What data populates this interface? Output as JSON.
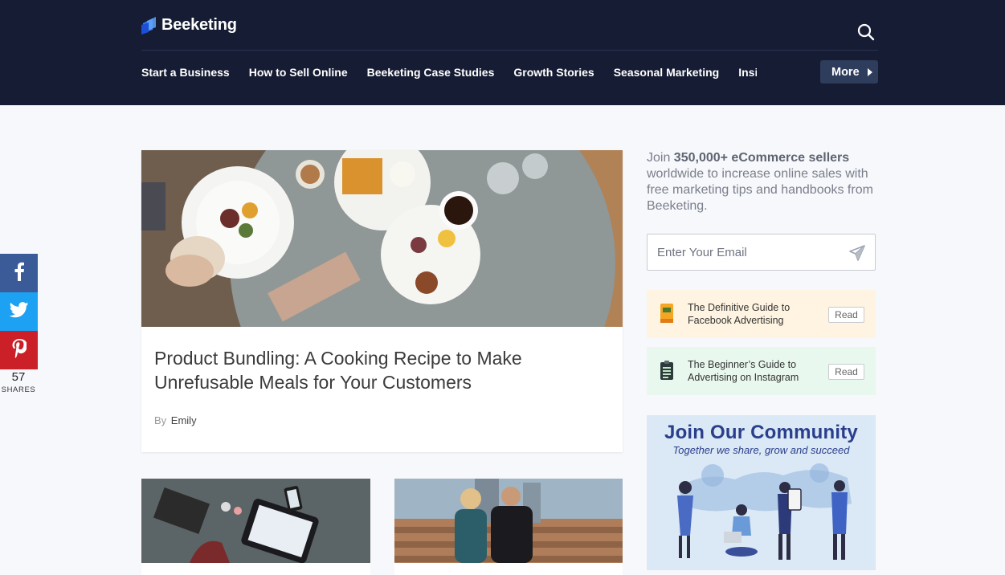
{
  "header": {
    "brand": "Beeketing",
    "nav_items": [
      "Start a Business",
      "How to Sell Online",
      "Beeketing Case Studies",
      "Growth Stories",
      "Seasonal Marketing",
      "Insid"
    ],
    "more_label": "More",
    "search_icon": "search-icon"
  },
  "share_bar": {
    "facebook": "f",
    "twitter": "twitter-icon",
    "pinterest": "P",
    "count": "57",
    "count_label": "SHARES"
  },
  "main_article": {
    "title": "Product Bundling: A Cooking Recipe to Make Unrefusable Meals for Your Customers",
    "by_label": "By",
    "author": "Emily"
  },
  "sidebar": {
    "intro_prefix": "Join ",
    "intro_bold": "350,000+ eCommerce sellers",
    "intro_rest": " worldwide to increase online sales with free marketing tips and handbooks from Beeketing.",
    "email_placeholder": "Enter Your Email",
    "guides": [
      {
        "title": "The Definitive Guide to Facebook Advertising",
        "button": "Read",
        "color": "#fff4e1"
      },
      {
        "title": "The Beginner’s Guide to Advertising on Instagram",
        "button": "Read",
        "color": "#e9f8ee"
      }
    ],
    "community_title": "Join Our Community",
    "community_subtitle": "Together we share, grow and succeed"
  },
  "colors": {
    "header_bg": "#161c33",
    "facebook": "#3b5a98",
    "twitter": "#1da1f2",
    "pinterest": "#cb2027",
    "accent": "#2a3f8c"
  }
}
